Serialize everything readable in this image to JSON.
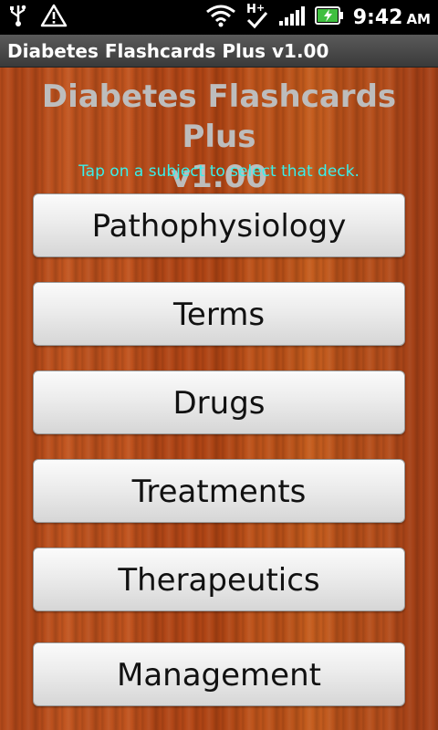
{
  "status_bar": {
    "time": "9:42",
    "ampm": "AM",
    "icons": [
      "usb-icon",
      "warning-icon",
      "wifi-icon",
      "hplus-icon",
      "signal-icon",
      "battery-icon"
    ]
  },
  "title_bar": {
    "text": "Diabetes Flashcards Plus v1.00"
  },
  "main": {
    "title_line1": "Diabetes Flashcards Plus",
    "title_line2": "v1.00",
    "hint": "Tap on a subject to select that deck.",
    "decks": [
      {
        "label": "Pathophysiology"
      },
      {
        "label": "Terms"
      },
      {
        "label": "Drugs"
      },
      {
        "label": "Treatments"
      },
      {
        "label": "Therapeutics"
      },
      {
        "label": "Management"
      }
    ]
  },
  "colors": {
    "hint": "#39f0ea",
    "title": "#bdbdbd",
    "wood": "#b54a1a"
  }
}
